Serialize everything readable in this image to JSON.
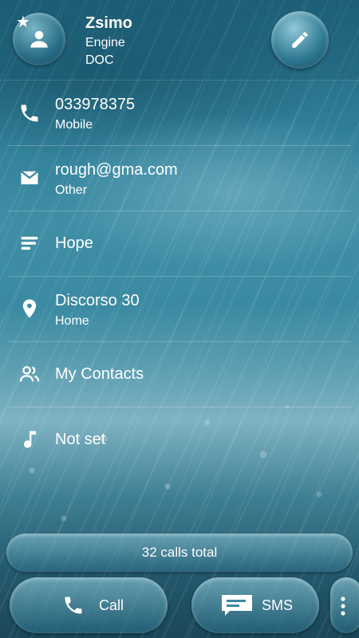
{
  "contact": {
    "name": "Zsimo",
    "line1": "Engine",
    "line2": "DOC"
  },
  "rows": [
    {
      "icon": "phone-icon",
      "primary": "033978375",
      "secondary": "Mobile"
    },
    {
      "icon": "email-icon",
      "primary": "rough@gma.com",
      "secondary": "Other"
    },
    {
      "icon": "notes-icon",
      "primary": "Hope"
    },
    {
      "icon": "location-pin-icon",
      "primary": "Discorso 30",
      "secondary": "Home"
    },
    {
      "icon": "group-icon",
      "primary": "My Contacts"
    },
    {
      "icon": "music-note-icon",
      "primary": "Not set"
    }
  ],
  "footer": {
    "calls_total": "32 calls total",
    "call_label": "Call",
    "sms_label": "SMS"
  },
  "colors": {
    "text": "#ffffff",
    "theme": "#2a6f86"
  }
}
